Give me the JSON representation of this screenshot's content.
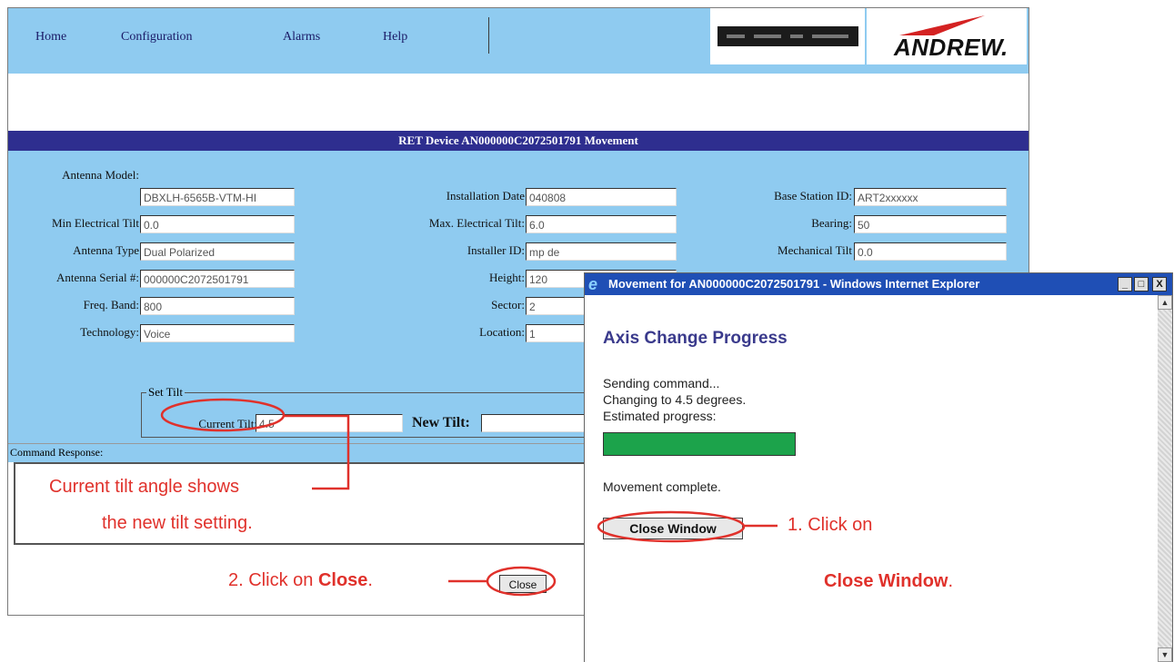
{
  "nav": {
    "home": "Home",
    "configuration": "Configuration",
    "alarms": "Alarms",
    "help": "Help"
  },
  "logo": {
    "text": "ANDREW.",
    "icon": "andrew-logo"
  },
  "device_image": {
    "icon": "base-station-unit"
  },
  "page_title": "RET Device AN000000C2072501791 Movement",
  "fields": {
    "antenna_model": {
      "label": "Antenna Model:",
      "value": "DBXLH-6565B-VTM-HI"
    },
    "min_electrical_tilt": {
      "label": "Min Electrical Tilt",
      "value": "0.0"
    },
    "antenna_type": {
      "label": "Antenna Type",
      "value": "Dual Polarized"
    },
    "antenna_serial": {
      "label": "Antenna Serial #:",
      "value": "000000C2072501791"
    },
    "freq_band": {
      "label": "Freq. Band:",
      "value": "800"
    },
    "technology": {
      "label": "Technology:",
      "value": "Voice"
    },
    "installation_date": {
      "label": "Installation Date",
      "value": "040808"
    },
    "max_electrical_tilt": {
      "label": "Max. Electrical Tilt:",
      "value": "6.0"
    },
    "installer_id": {
      "label": "Installer ID:",
      "value": "mp de"
    },
    "height": {
      "label": "Height:",
      "value": "120"
    },
    "sector": {
      "label": "Sector:",
      "value": "2"
    },
    "location": {
      "label": "Location:",
      "value": "1"
    },
    "base_station_id": {
      "label": "Base Station ID:",
      "value": "ART2xxxxxx"
    },
    "bearing": {
      "label": "Bearing:",
      "value": "50"
    },
    "mechanical_tilt": {
      "label": "Mechanical Tilt",
      "value": "0.0"
    }
  },
  "set_tilt": {
    "legend": "Set Tilt",
    "current_label": "Current Tilt:",
    "current_value": "4.5",
    "new_label": "New Tilt:",
    "new_value": ""
  },
  "command_response": {
    "label": "Command Response:",
    "value": ""
  },
  "close_button": "Close",
  "popup": {
    "title": "Movement for AN000000C2072501791 - Windows Internet Explorer",
    "heading": "Axis Change Progress",
    "lines": [
      "Sending command...",
      "Changing to 4.5 degrees.",
      "Estimated progress:"
    ],
    "progress": 1.0,
    "status": "Movement complete.",
    "close_window_button": "Close Window",
    "win_buttons": {
      "minimize": "_",
      "maximize": "□",
      "close": "X"
    }
  },
  "annotations": {
    "tilt_note_line1": "Current tilt angle shows",
    "tilt_note_line2": "the new tilt setting.",
    "step1_prefix": "1.  Click on",
    "step1_bold": "Close Window",
    "step1_suffix": ".",
    "step2_prefix": "2.  Click on ",
    "step2_bold": "Close",
    "step2_suffix": "."
  },
  "colors": {
    "page_bg": "#8fcbf0",
    "title_bar": "#2e2e8f",
    "popup_title": "#1f4fb5",
    "progress": "#1ca34b",
    "annotation": "#e0312b"
  }
}
